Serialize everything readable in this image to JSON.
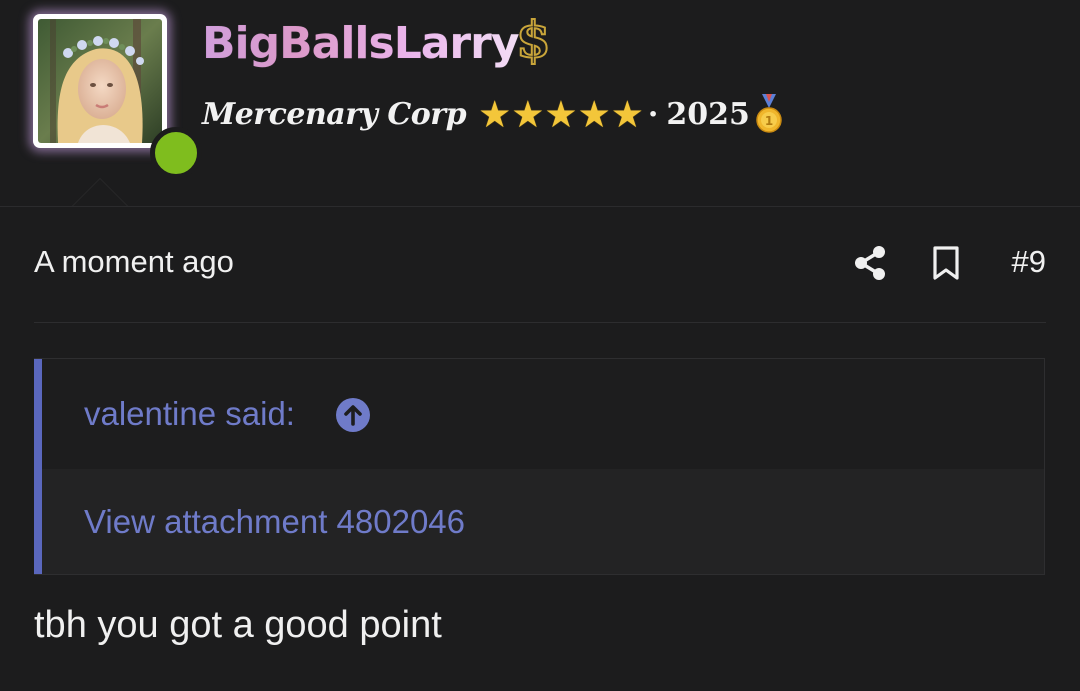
{
  "user": {
    "name": "BigBallsLarry",
    "badge_icon": "dollar-icon",
    "title": "Mercenary Corp",
    "stars": "★★★★★",
    "separator": "·",
    "year": "2025",
    "year_badge_icon": "gold-medal-icon",
    "online": true,
    "online_color": "#7fbd1e",
    "name_gradient": [
      "#c98fd6",
      "#d688c0",
      "#e6a8e8",
      "#f1d8f4"
    ]
  },
  "post": {
    "time": "A moment ago",
    "number": "#9",
    "share_icon": "share-icon",
    "bookmark_icon": "bookmark-icon"
  },
  "quote": {
    "author_line": "valentine said:",
    "jump_icon": "arrow-up-circle-icon",
    "attachment_text": "View attachment 4802046",
    "accent_color": "#5a67bd",
    "link_color": "#6f7bc9"
  },
  "message": {
    "text": "tbh you got a good point"
  }
}
